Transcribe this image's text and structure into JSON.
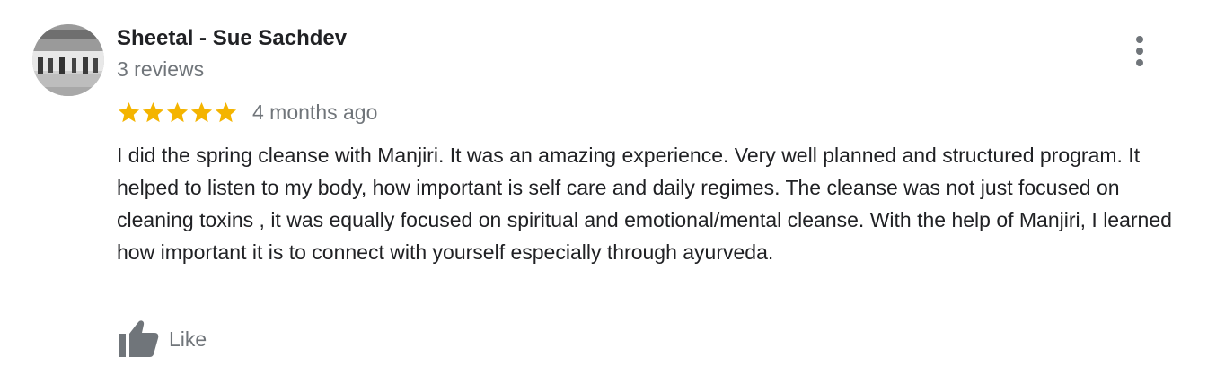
{
  "review": {
    "author_name": "Sheetal - Sue Sachdev",
    "author_meta": "3 reviews",
    "rating": 5,
    "rating_max": 5,
    "star_color": "#f4b400",
    "date": "4 months ago",
    "text": "I did the spring cleanse with Manjiri. It was an amazing experience. Very well planned and structured program. It helped to listen to my body, how important is self care and daily regimes. The cleanse was not just focused on cleaning toxins , it was equally focused on spiritual and emotional/mental cleanse. With the help of Manjiri, I learned how important it is to connect with yourself especially through ayurveda.",
    "like_label": "Like",
    "icons": {
      "avatar": "avatar-photo",
      "more": "more-vert-icon",
      "like": "thumbs-up-icon",
      "star": "star-icon"
    }
  }
}
